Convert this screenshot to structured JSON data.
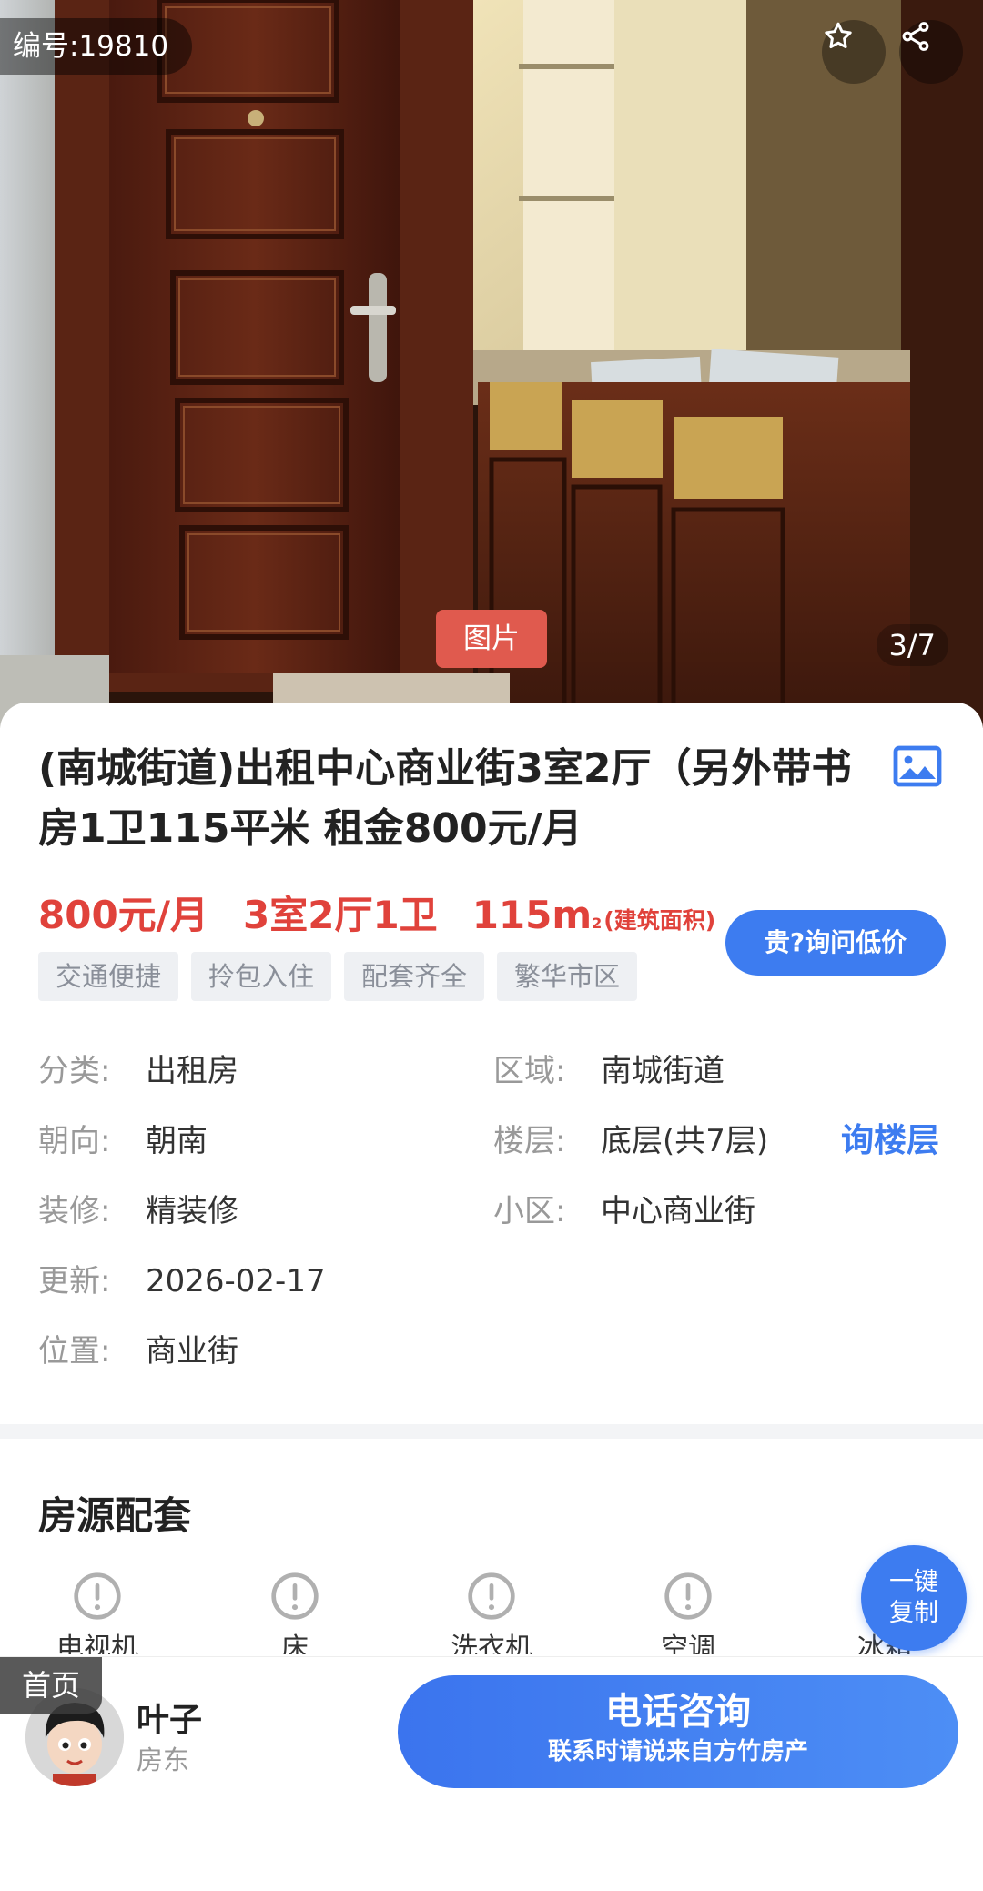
{
  "hero": {
    "listing_id": "编号:19810",
    "photo_tag": "图片",
    "photo_counter": "3/7"
  },
  "listing": {
    "title": "(南城街道)出租中心商业街3室2厅（另外带书房1卫115平米 租金800元/月",
    "price": "800元/月",
    "layout": "3室2厅1卫",
    "area": "115m",
    "area_sup": "2",
    "area_note": "(建筑面积)",
    "ask_low_price": "贵?询问低价",
    "tags": [
      "交通便捷",
      "拎包入住",
      "配套齐全",
      "繁华市区"
    ]
  },
  "info": {
    "category_label": "分类:",
    "category_value": "出租房",
    "region_label": "区域:",
    "region_value": "南城街道",
    "orientation_label": "朝向:",
    "orientation_value": "朝南",
    "floor_label": "楼层:",
    "floor_value": "底层(共7层)",
    "ask_floor": "询楼层",
    "decoration_label": "装修:",
    "decoration_value": "精装修",
    "community_label": "小区:",
    "community_value": "中心商业街",
    "updated_label": "更新:",
    "updated_value": "2026-02-17",
    "location_label": "位置:",
    "location_value": "商业街"
  },
  "amenities": {
    "title": "房源配套",
    "items": [
      "电视机",
      "床",
      "洗衣机",
      "空调",
      "冰箱"
    ]
  },
  "copy_button": {
    "line1": "一键",
    "line2": "复制"
  },
  "bottom": {
    "home_tab": "首页",
    "agent_name": "叶子",
    "agent_role": "房东",
    "call_main": "电话咨询",
    "call_sub": "联系时请说来自方竹房产"
  },
  "colors": {
    "accent_blue": "#3d7cf0",
    "price_red": "#e0423b"
  },
  "icons": [
    "star-icon",
    "share-icon",
    "image-icon",
    "alert-circle-icon"
  ]
}
